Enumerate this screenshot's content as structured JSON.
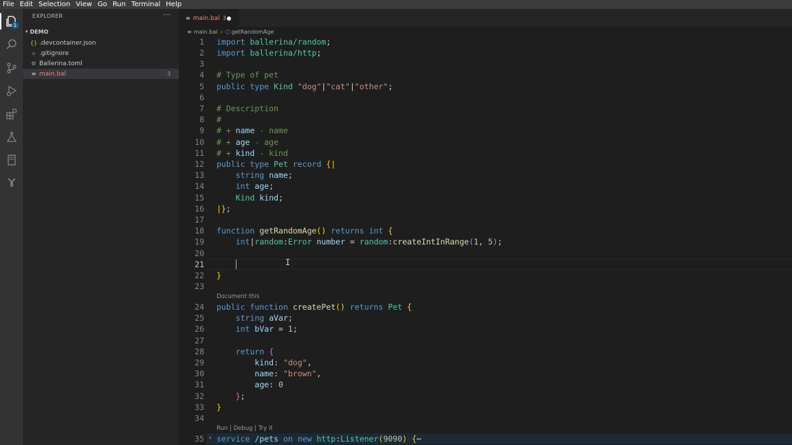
{
  "menu": [
    "File",
    "Edit",
    "Selection",
    "View",
    "Go",
    "Run",
    "Terminal",
    "Help"
  ],
  "activity": {
    "explorer_badge": "1"
  },
  "explorer": {
    "title": "EXPLORER",
    "more": "···",
    "folder": "DEMO",
    "files": [
      {
        "icon": "{}",
        "name": ".devcontainer.json"
      },
      {
        "icon": "◆",
        "name": ".gitignore"
      },
      {
        "icon": "⚙",
        "name": "Ballerina.toml"
      },
      {
        "icon": "≡",
        "name": "main.bal",
        "count": "3"
      }
    ]
  },
  "tab": {
    "name": "main.bal",
    "count": "3"
  },
  "breadcrumb": {
    "file": "main.bal",
    "symbol": "getRandomAge"
  },
  "code_lens": {
    "document": "Document this",
    "service": "Run | Debug | Try it"
  },
  "line_numbers": [
    "1",
    "2",
    "3",
    "4",
    "5",
    "6",
    "7",
    "8",
    "9",
    "10",
    "11",
    "12",
    "13",
    "14",
    "15",
    "16",
    "17",
    "18",
    "19",
    "20",
    "21",
    "22",
    "23",
    "24",
    "25",
    "26",
    "27",
    "28",
    "29",
    "30",
    "31",
    "32",
    "33",
    "34",
    "35"
  ]
}
